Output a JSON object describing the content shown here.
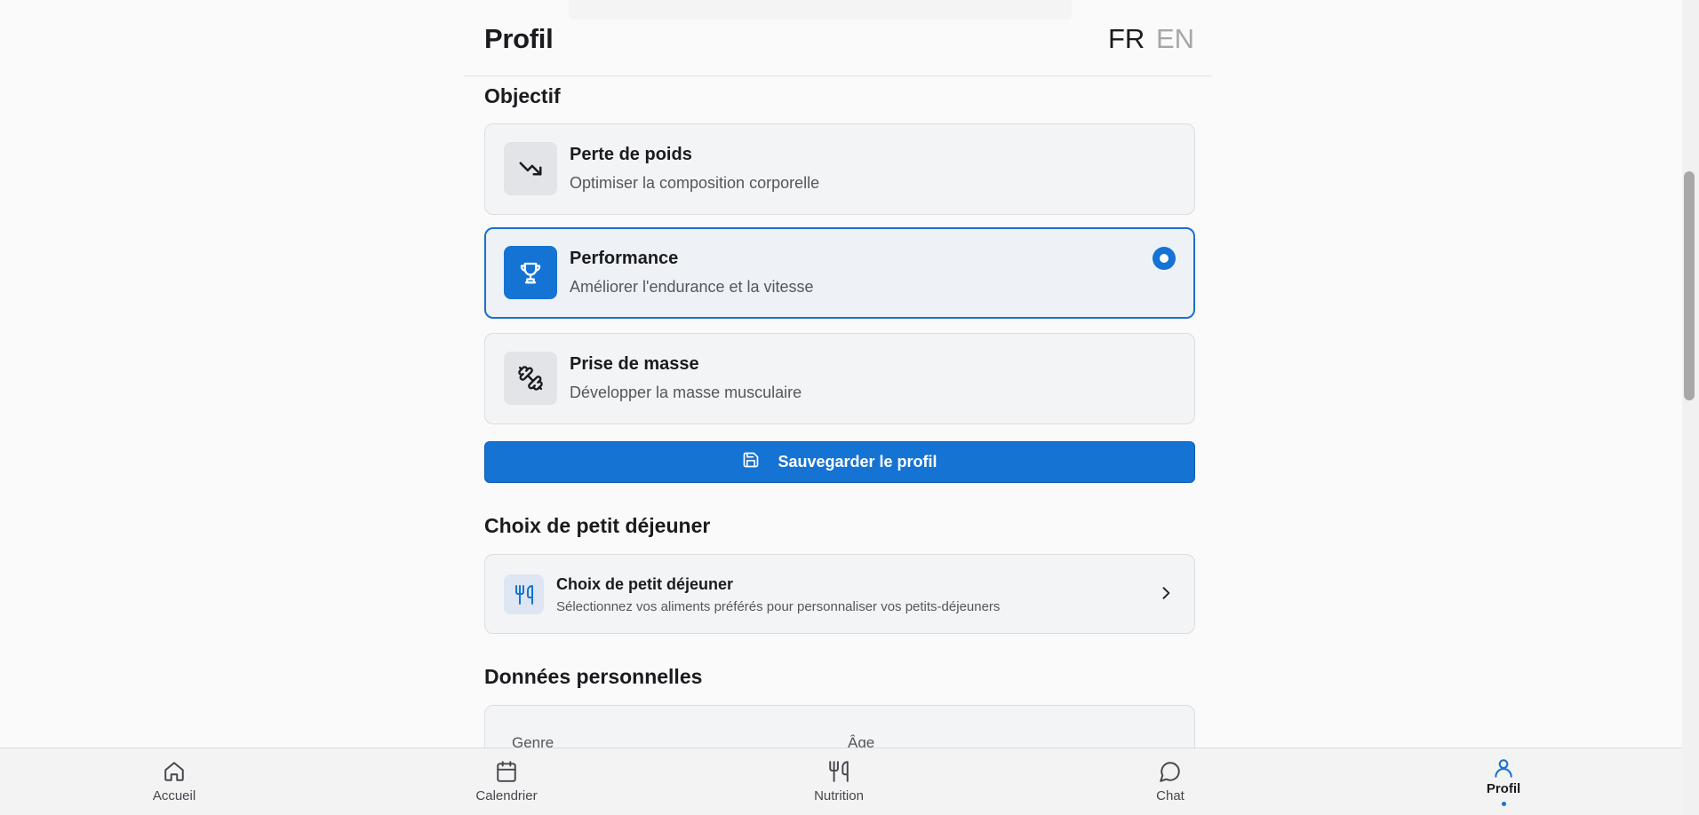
{
  "header": {
    "title": "Profil",
    "lang_fr": "FR",
    "lang_en": "EN"
  },
  "objective": {
    "section_title": "Objectif",
    "options": [
      {
        "title": "Perte de poids",
        "subtitle": "Optimiser la composition corporelle",
        "icon": "trending-down-icon",
        "selected": false
      },
      {
        "title": "Performance",
        "subtitle": "Améliorer l'endurance et la vitesse",
        "icon": "trophy-icon",
        "selected": true
      },
      {
        "title": "Prise de masse",
        "subtitle": "Développer la masse musculaire",
        "icon": "dumbbell-icon",
        "selected": false
      }
    ]
  },
  "save_button": {
    "label": "Sauvegarder le profil",
    "icon": "save-icon"
  },
  "breakfast": {
    "section_title": "Choix de petit déjeuner",
    "card_title": "Choix de petit déjeuner",
    "card_subtitle": "Sélectionnez vos aliments préférés pour personnaliser vos petits-déjeuners",
    "icon": "utensils-icon"
  },
  "personal": {
    "section_title": "Données personnelles",
    "labels": [
      "Genre",
      "Âge"
    ]
  },
  "nav": {
    "items": [
      {
        "label": "Accueil",
        "icon": "home-icon"
      },
      {
        "label": "Calendrier",
        "icon": "calendar-icon"
      },
      {
        "label": "Nutrition",
        "icon": "utensils-icon"
      },
      {
        "label": "Chat",
        "icon": "chat-icon"
      },
      {
        "label": "Profil",
        "icon": "user-icon",
        "active": true
      }
    ]
  },
  "colors": {
    "accent": "#1573d4",
    "text": "#1b1b1f",
    "muted": "#55565c",
    "card_bg": "#f3f4f6"
  }
}
